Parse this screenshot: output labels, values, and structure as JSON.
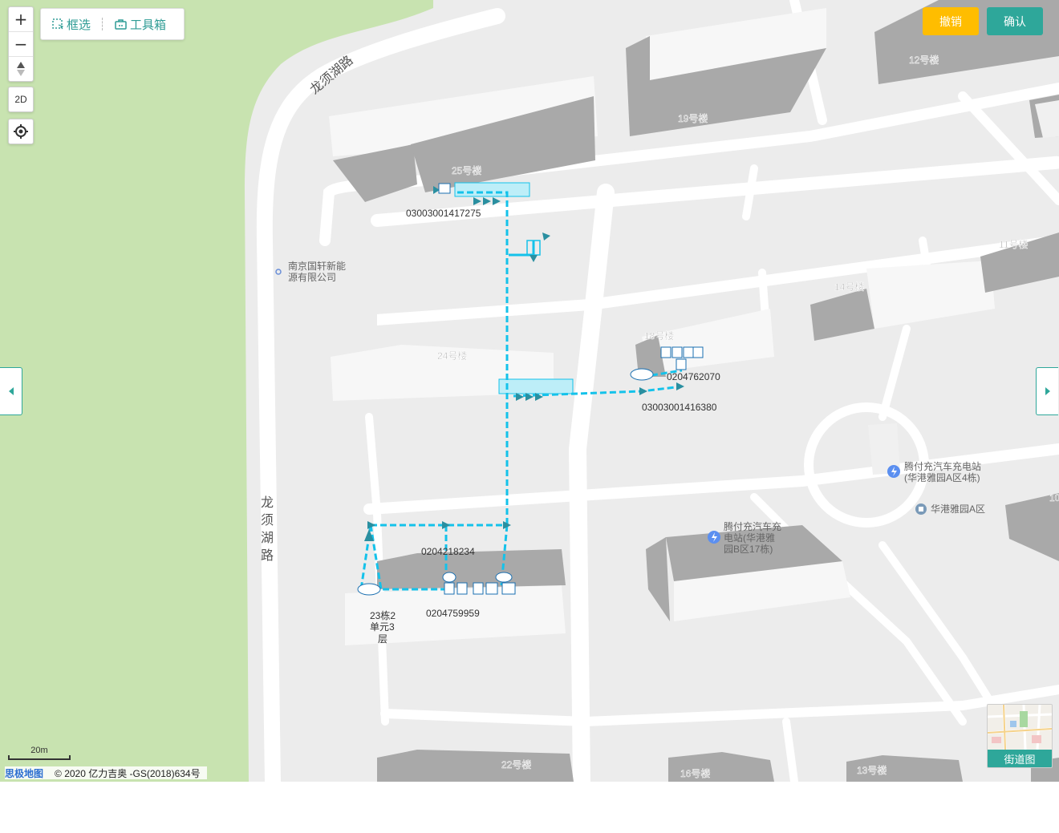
{
  "controls": {
    "zoom_in": "+",
    "zoom_out": "−",
    "compass": "▲",
    "mode_2d": "2D"
  },
  "toolbar": {
    "select_label": "框选",
    "toolbox_label": "工具箱"
  },
  "actions": {
    "cancel_label": "撤销",
    "confirm_label": "确认",
    "cancel_color": "#ffbd00",
    "confirm_color": "#2ea79a"
  },
  "map": {
    "roads": [
      "龙须湖路",
      "龙\n须\n湖\n路"
    ],
    "buildings": [
      "25号楼",
      "19号楼",
      "12号楼",
      "24号楼",
      "18号楼",
      "14号楼",
      "11号楼",
      "22号楼",
      "16号楼",
      "13号楼",
      "10"
    ],
    "pois": [
      {
        "name": "南京国轩新能源有限公司",
        "icon": "dot"
      },
      {
        "name": "腾付充汽车充电站(华港雅园A区4栋)",
        "icon": "charging-icon"
      },
      {
        "name": "华港雅园A区",
        "icon": "residential-icon"
      },
      {
        "name": "腾付充汽车充电站(华港雅园B区17栋)",
        "icon": "charging-icon"
      }
    ],
    "line_ids": [
      "03003001417275",
      "0204762070",
      "03003001416380",
      "0204218234",
      "0204759959"
    ],
    "unit_label": "23栋2单元3层",
    "line_color": "#14c2ea"
  },
  "scale": {
    "label": "20m"
  },
  "attribution": {
    "logo": "思极地图",
    "copyright": "© 2020 亿力吉奥 -GS(2018)634号"
  },
  "street_view": {
    "label": "街道图"
  }
}
